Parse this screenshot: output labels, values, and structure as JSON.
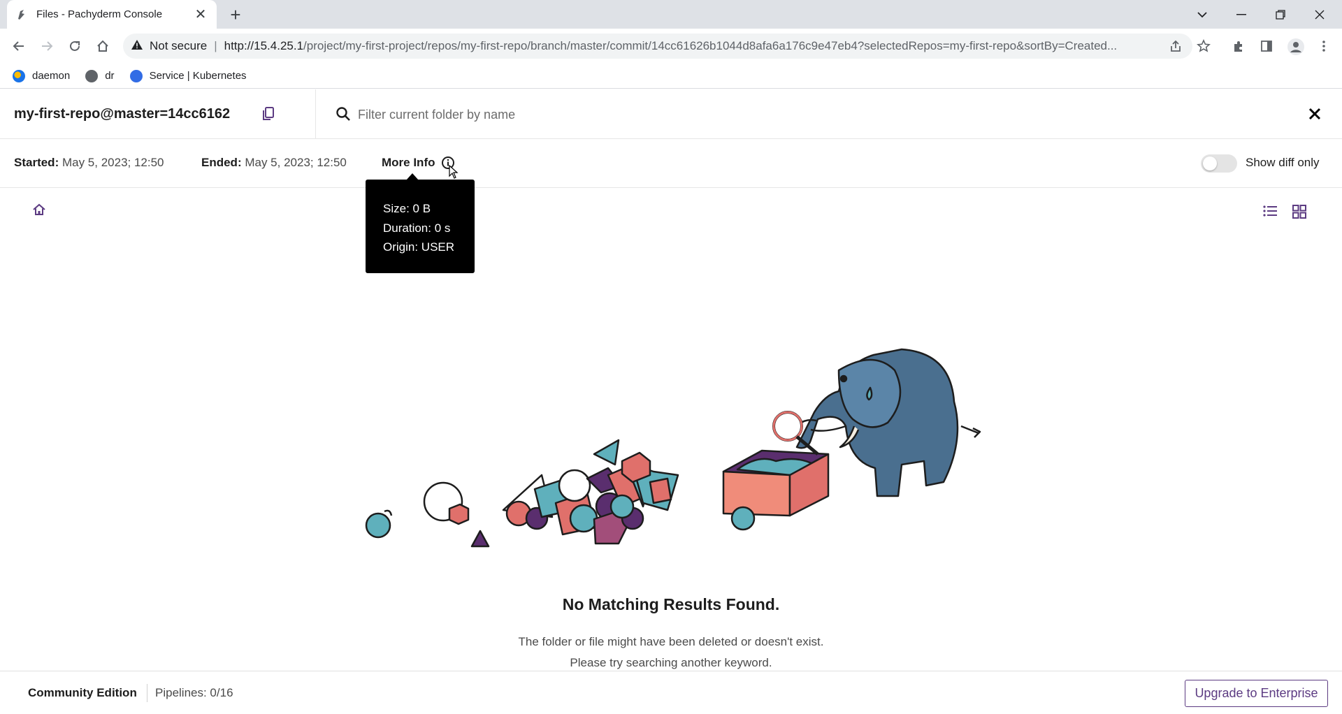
{
  "browser": {
    "tab_title": "Files - Pachyderm Console",
    "tab_close": "✕",
    "new_tab": "+",
    "security_label": "Not secure",
    "url_host": "http://15.4.25.1",
    "url_path": "/project/my-first-project/repos/my-first-repo/branch/master/commit/14cc61626b1044d8afa6a176c9e47eb4?selectedRepos=my-first-repo&sortBy=Created...",
    "bookmarks": [
      {
        "label": "daemon",
        "color": "#1a73e8"
      },
      {
        "label": "dr",
        "color": "#5f6368"
      },
      {
        "label": "Service | Kubernetes",
        "color": "#326ce5"
      }
    ]
  },
  "header": {
    "repo_title": "my-first-repo@master=14cc6162",
    "search_placeholder": "Filter current folder by name"
  },
  "info": {
    "started_label": "Started:",
    "started_value": "May 5, 2023; 12:50",
    "ended_label": "Ended:",
    "ended_value": "May 5, 2023; 12:50",
    "more_info_label": "More Info",
    "show_diff_label": "Show diff only",
    "show_diff_on": false
  },
  "tooltip": {
    "size": "Size: 0 B",
    "duration": "Duration: 0 s",
    "origin": "Origin: USER"
  },
  "empty_state": {
    "title": "No Matching Results Found.",
    "message": "The folder or file might have been deleted or doesn't exist. Please try searching another keyword."
  },
  "footer": {
    "edition": "Community Edition",
    "pipelines": "Pipelines: 0/16",
    "upgrade_label": "Upgrade to Enterprise"
  },
  "colors": {
    "brand_purple": "#5c3b82",
    "elephant_blue": "#4a6f8f",
    "teal": "#5fb0bc",
    "coral": "#e0706b",
    "dark_purple": "#5a2e6e"
  }
}
